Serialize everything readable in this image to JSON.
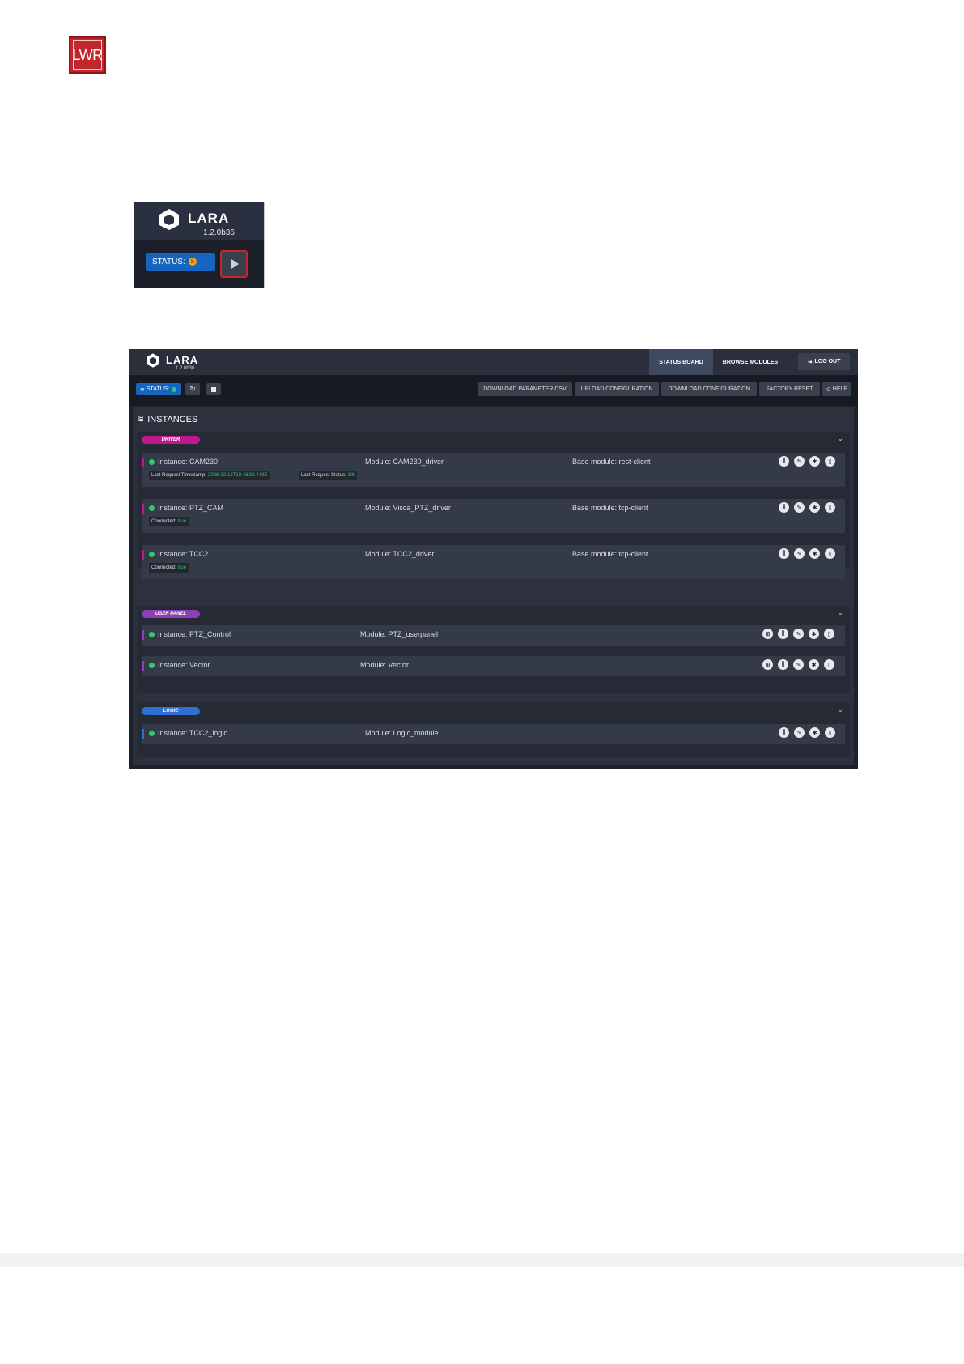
{
  "doc": {
    "logo_text": "LWR"
  },
  "crop": {
    "brand": "LARA",
    "version": "1.2.0b36",
    "status_label": "STATUS:",
    "status_dot": "x",
    "play_icon": "play-icon"
  },
  "app": {
    "brand": "LARA",
    "version": "1.2.0b36",
    "nav": {
      "status_board": "STATUS BOARD",
      "browse_modules": "BROWSE MODULES",
      "logout": "LOG OUT"
    },
    "toolbar": {
      "status_label": "STATUS:",
      "refresh_icon": "refresh-icon",
      "stop_icon": "stop-icon",
      "actions": [
        "DOWNLOAD PARAMETER CSV",
        "UPLOAD CONFIGURATION",
        "DOWNLOAD CONFIGURATION",
        "FACTORY RESET",
        "HELP"
      ]
    },
    "instances_title": "INSTANCES",
    "groups": [
      {
        "label": "DRIVER",
        "color": "#c2188f",
        "rows": [
          {
            "instance": "Instance: CAM230",
            "module": "Module: CAM230_driver",
            "base": "Base module: rest-client",
            "tags": [
              {
                "k": "Last Request Timestamp:",
                "v": "2026-02-12T10:46:38.449Z"
              },
              {
                "k": "Last Request Status:",
                "v": "OK"
              }
            ]
          },
          {
            "instance": "Instance: PTZ_CAM",
            "module": "Module: Visca_PTZ_driver",
            "base": "Base module: tcp-client",
            "tags": [
              {
                "k": "Connected:",
                "v": "true"
              }
            ]
          },
          {
            "instance": "Instance: TCC2",
            "module": "Module: TCC2_driver",
            "base": "Base module: tcp-client",
            "tags": [
              {
                "k": "Connected:",
                "v": "true"
              }
            ]
          }
        ]
      },
      {
        "label": "USER PANEL",
        "color": "#8e3fb7",
        "rows": [
          {
            "instance": "Instance: PTZ_Control",
            "module": "Module: PTZ_userpanel"
          },
          {
            "instance": "Instance: Vector",
            "module": "Module: Vector"
          }
        ]
      },
      {
        "label": "LOGIC",
        "color": "#2e6fd1",
        "rows": [
          {
            "instance": "Instance: TCC2_logic",
            "module": "Module: Logic_module"
          }
        ]
      }
    ],
    "colors": {
      "ok": "#2ecc71",
      "primary": "#1565c0"
    }
  }
}
